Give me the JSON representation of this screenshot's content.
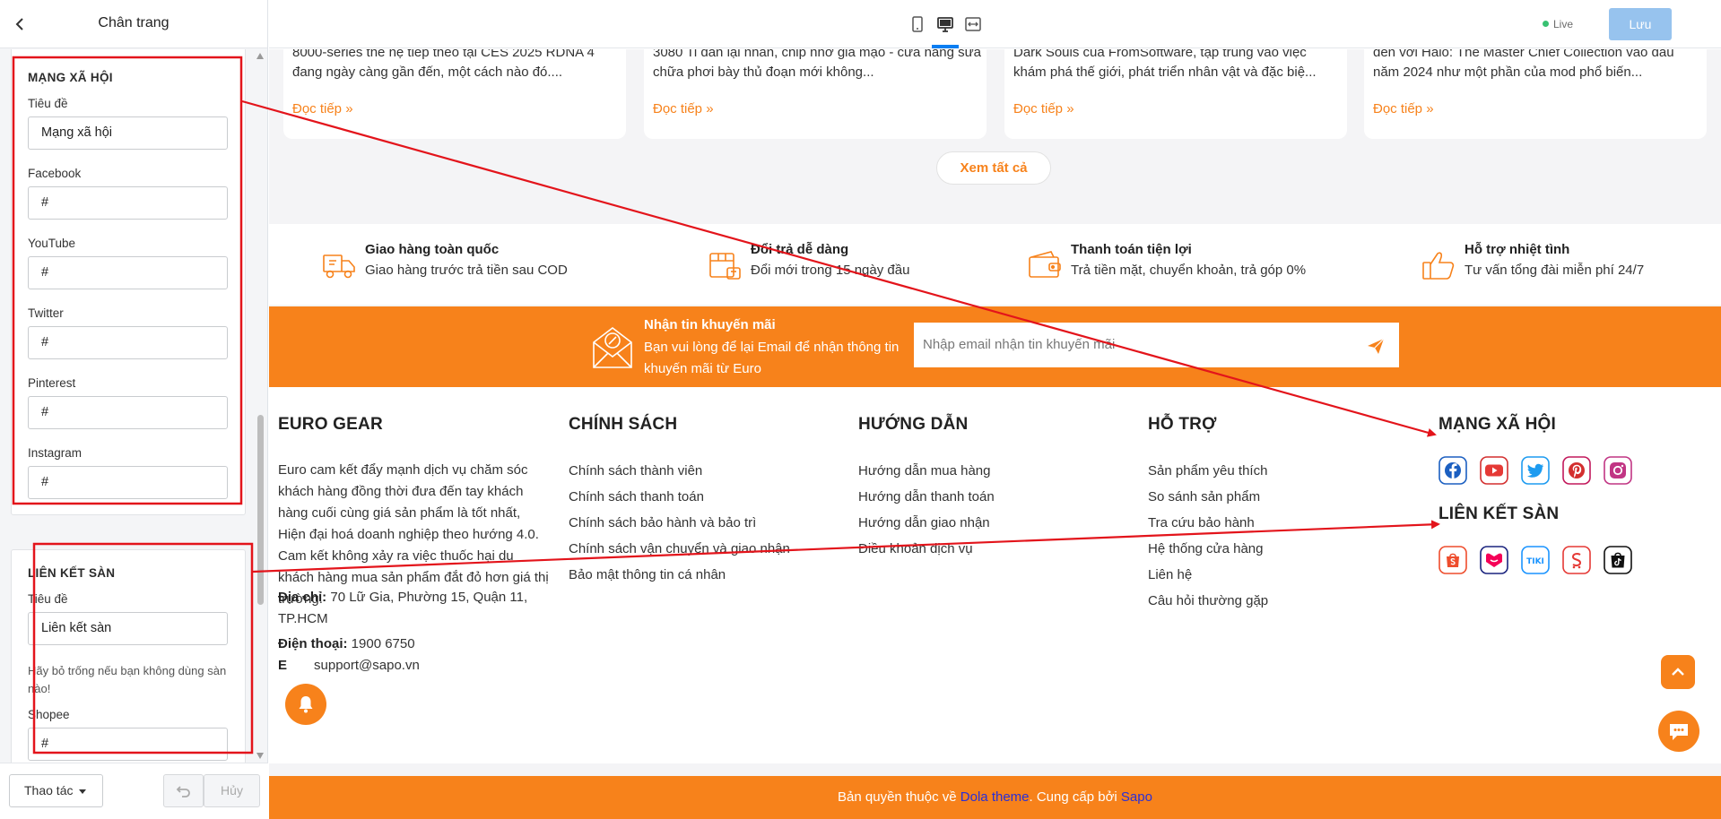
{
  "left_panel": {
    "title": "Chân trang",
    "social": {
      "section_title": "MẠNG XÃ HỘI",
      "fields": [
        {
          "label": "Tiêu đề",
          "value": "Mạng xã hội"
        },
        {
          "label": "Facebook",
          "value": "#"
        },
        {
          "label": "YouTube",
          "value": "#"
        },
        {
          "label": "Twitter",
          "value": "#"
        },
        {
          "label": "Pinterest",
          "value": "#"
        },
        {
          "label": "Instagram",
          "value": "#"
        }
      ]
    },
    "marketplace": {
      "section_title": "LIÊN KẾT SÀN",
      "title_label": "Tiêu đề",
      "title_value": "Liên kết sàn",
      "hint": "Hãy bỏ trống nếu bạn không dùng sàn nào!",
      "shopee_label": "Shopee",
      "shopee_value": "#"
    },
    "footer": {
      "actions_label": "Thao tác",
      "cancel_label": "Hủy"
    }
  },
  "topbar": {
    "live_label": "Live",
    "save_label": "Lưu"
  },
  "preview": {
    "blogs": [
      {
        "excerpt": "8000-series thế hệ tiếp theo tại CES 2025 RDNA 4 đang ngày càng gần đến, một cách nào đó....",
        "read_more": "Đọc tiếp »"
      },
      {
        "excerpt": "3080 Ti dán lại nhãn, chip nhớ giả mạo - cửa hàng sửa chữa phơi bày thủ đoạn mới không...",
        "read_more": "Đọc tiếp »"
      },
      {
        "excerpt": "Dark Souls của FromSoftware, tập trung vào việc khám phá thế giới, phát triển nhân vật và đặc biệ...",
        "read_more": "Đọc tiếp »"
      },
      {
        "excerpt": "đến với Halo: The Master Chief Collection vào đầu năm 2024 như một phần của mod phổ biến...",
        "read_more": "Đọc tiếp »"
      }
    ],
    "see_all": "Xem tất cả",
    "features": [
      {
        "title": "Giao hàng toàn quốc",
        "desc": "Giao hàng trước trả tiền sau COD"
      },
      {
        "title": "Đổi trả dễ dàng",
        "desc": "Đổi mới trong 15 ngày đầu"
      },
      {
        "title": "Thanh toán tiện lợi",
        "desc": "Trả tiền mặt, chuyển khoản, trả góp 0%"
      },
      {
        "title": "Hỗ trợ nhiệt tình",
        "desc": "Tư vấn tổng đài miễn phí 24/7"
      }
    ],
    "newsletter": {
      "title": "Nhận tin khuyến mãi",
      "desc": "Bạn vui lòng để lại Email để nhận thông tin khuyến mãi từ Euro",
      "placeholder": "Nhập email nhận tin khuyến mãi"
    },
    "footer": {
      "brand": "EURO GEAR",
      "about": "Euro cam kết đẩy mạnh dịch vụ chăm sóc khách hàng đồng thời đưa đến tay khách hàng cuối cùng giá sản phẩm là tốt nhất, Hiện đại hoá doanh nghiệp theo hướng 4.0. Cam kết không xảy ra việc thuốc hại dụ khách hàng mua sản phẩm đắt đỏ hơn giá thị trường.",
      "address_label": "Địa chỉ:",
      "address": "70 Lữ Gia, Phường 15, Quận 11, TP.HCM",
      "phone_label": "Điện thoại:",
      "phone": "1900 6750",
      "email_label": "E",
      "email": "support@sapo.vn",
      "policy_title": "CHÍNH SÁCH",
      "policy_links": [
        "Chính sách thành viên",
        "Chính sách thanh toán",
        "Chính sách bảo hành và bảo trì",
        "Chính sách vận chuyển và giao nhận",
        "Bảo mật thông tin cá nhân"
      ],
      "guide_title": "HƯỚNG DẪN",
      "guide_links": [
        "Hướng dẫn mua hàng",
        "Hướng dẫn thanh toán",
        "Hướng dẫn giao nhận",
        "Điều khoản dịch vụ"
      ],
      "support_title": "HỖ TRỢ",
      "support_links": [
        "Sản phẩm yêu thích",
        "So sánh sản phẩm",
        "Tra cứu bảo hành",
        "Hệ thống cửa hàng",
        "Liên hệ",
        "Câu hỏi thường gặp"
      ],
      "social_title": "MẠNG XÃ HỘI",
      "social_icons": [
        "facebook-icon",
        "youtube-icon",
        "twitter-icon",
        "pinterest-icon",
        "instagram-icon"
      ],
      "market_title": "LIÊN KẾT SÀN",
      "market_icons": [
        "shopee-icon",
        "lazada-icon",
        "tiki-icon",
        "sendo-icon",
        "tiktok-shop-icon"
      ]
    },
    "copyright": {
      "prefix": "Bản quyền thuộc về ",
      "dola": "Dola theme",
      "mid": ". Cung cấp bởi ",
      "sapo": "Sapo"
    }
  },
  "colors": {
    "accent": "#f7821b",
    "primary_blue": "#0a7ef2",
    "annotation_red": "#e3141b",
    "save_button": "#97c3ee"
  }
}
